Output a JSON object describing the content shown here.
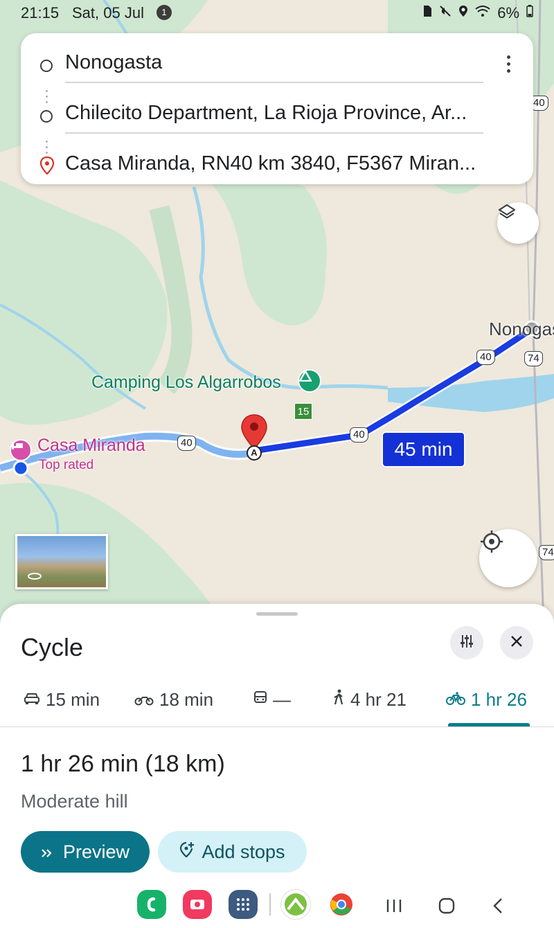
{
  "status_bar": {
    "time": "21:15",
    "date": "Sat, 05 Jul",
    "notification_count": "1",
    "battery": "6%"
  },
  "directions": {
    "origin": "Nonogasta",
    "waypoint": "Chilecito Department, La Rioja Province, Ar...",
    "destination": "Casa Miranda, RN40 km 3840, F5367 Miran..."
  },
  "map": {
    "places": {
      "camping": "Camping Los Algarrobos",
      "lodging": "Casa Miranda",
      "lodging_tag": "Top rated",
      "town": "Nonogasta"
    },
    "road_shields": {
      "route_40": "40",
      "route_74": "74",
      "route_15": "15"
    },
    "start_marker": "A",
    "duration_tag": "45 min",
    "colors": {
      "route": "#1a3ce0",
      "park_green": "#c8e6c9",
      "water": "#9fd4ec",
      "land": "#efe8dc"
    }
  },
  "sheet": {
    "title": "Cycle",
    "modes": [
      {
        "icon": "car-icon",
        "label": "15 min"
      },
      {
        "icon": "motorcycle-icon",
        "label": "18 min"
      },
      {
        "icon": "transit-icon",
        "label": "—"
      },
      {
        "icon": "walking-icon",
        "label": "4 hr 21"
      },
      {
        "icon": "bicycle-icon",
        "label": "1 hr 26"
      }
    ],
    "active_mode": "bicycle",
    "summary": "1 hr 26 min (18 km)",
    "terrain": "Moderate hill",
    "preview_label": "Preview",
    "add_stops_label": "Add stops",
    "accent": "#0b7488"
  },
  "navbar": {
    "apps": [
      "phone-app",
      "screen-recorder-app",
      "app-drawer",
      "maps-app",
      "chrome-app"
    ]
  }
}
